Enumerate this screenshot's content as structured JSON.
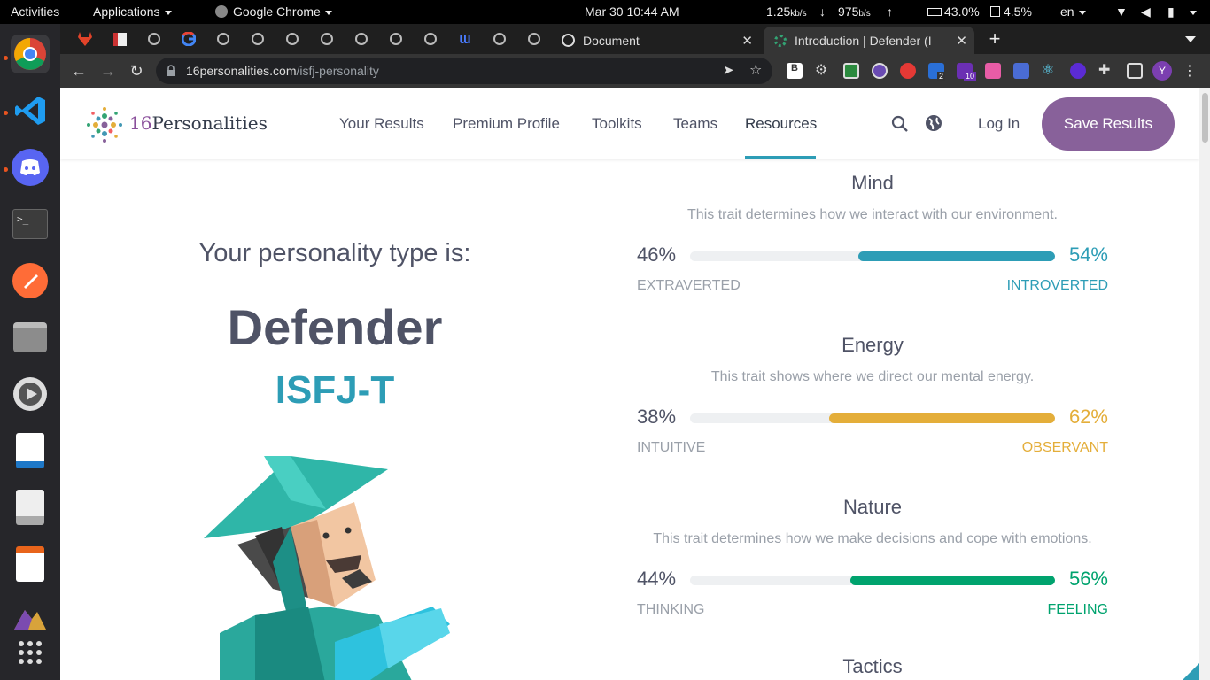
{
  "system": {
    "activities": "Activities",
    "applications": "Applications",
    "browser_app": "Google Chrome",
    "datetime": "Mar 30  10:44 AM",
    "net_up": "1.25",
    "net_up_unit": "kb/s",
    "net_down": "975",
    "net_down_unit": "b/s",
    "battery": "43.0%",
    "memory": "4.5%",
    "lang": "en"
  },
  "browser": {
    "tabs": [
      {
        "title": "Document"
      },
      {
        "title": "Introduction | Defender (I"
      }
    ],
    "url_host": "16personalities.com",
    "url_path": "/isfj-personality",
    "ext_badges": {
      "a": "2",
      "b": "10"
    },
    "profile_initial": "Y"
  },
  "site": {
    "logo_num": "16",
    "logo_word": "Personalities",
    "nav": [
      "Your Results",
      "Premium Profile",
      "Toolkits",
      "Teams",
      "Resources"
    ],
    "login": "Log In",
    "save": "Save Results",
    "accent": "#88619a"
  },
  "result": {
    "intro": "Your personality type is:",
    "name": "Defender",
    "code": "ISFJ-T"
  },
  "traits": [
    {
      "title": "Mind",
      "desc": "This trait determines how we interact with our environment.",
      "left_pct": "46%",
      "right_pct": "54%",
      "right_value": 0.54,
      "left_label": "EXTRAVERTED",
      "right_label": "INTROVERTED",
      "color": "#2d9db6"
    },
    {
      "title": "Energy",
      "desc": "This trait shows where we direct our mental energy.",
      "left_pct": "38%",
      "right_pct": "62%",
      "right_value": 0.62,
      "left_label": "INTUITIVE",
      "right_label": "OBSERVANT",
      "color": "#e4ae3a"
    },
    {
      "title": "Nature",
      "desc": "This trait determines how we make decisions and cope with emotions.",
      "left_pct": "44%",
      "right_pct": "56%",
      "right_value": 0.56,
      "left_label": "THINKING",
      "right_label": "FEELING",
      "color": "#00a36e"
    }
  ],
  "next_trait": "Tactics"
}
